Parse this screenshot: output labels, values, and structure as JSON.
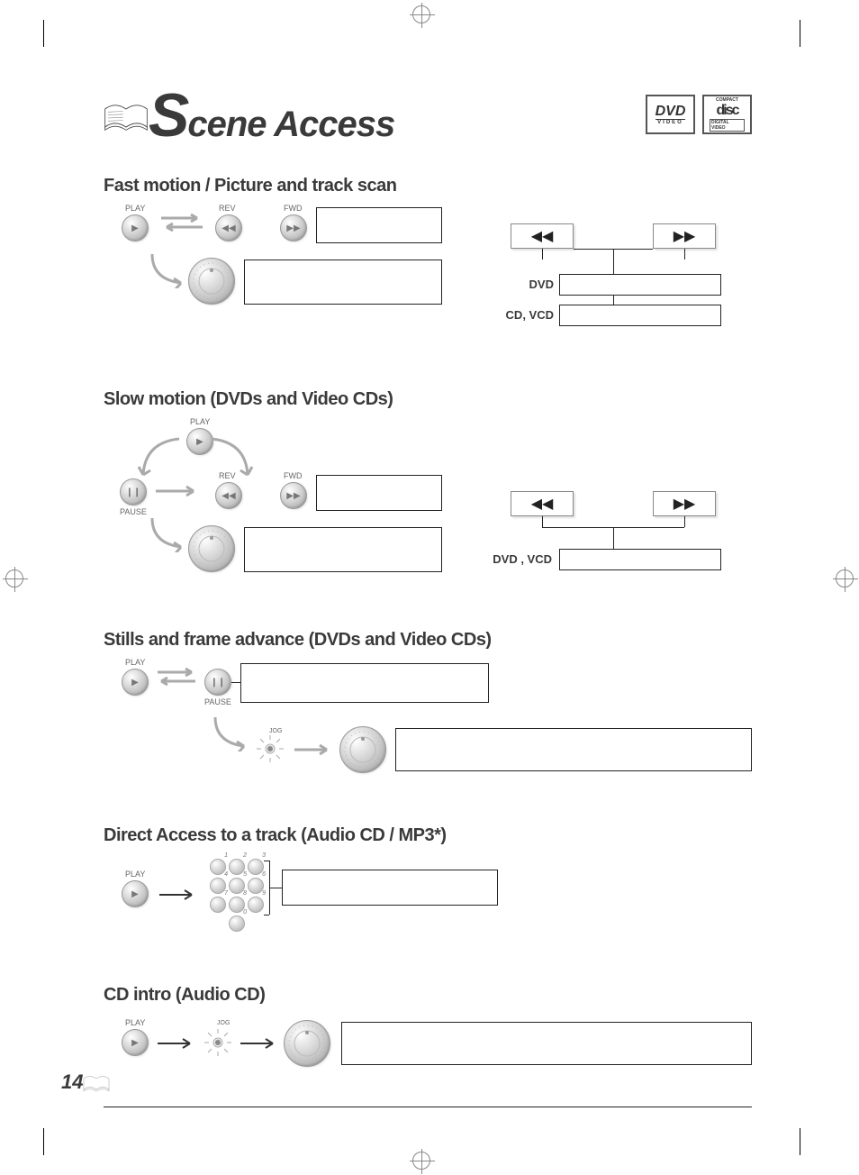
{
  "page_number": "14",
  "title": {
    "big_letter": "S",
    "rest": "cene Access"
  },
  "logos": {
    "dvd": {
      "top": "DVD",
      "bottom": "VIDEO"
    },
    "disc": {
      "top": "COMPACT",
      "mid": "disc",
      "bottom": "DIGITAL VIDEO"
    }
  },
  "sections": {
    "fast": {
      "heading": "Fast motion / Picture and track scan",
      "play": "PLAY",
      "rev": "REV",
      "fwd": "FWD",
      "rows": {
        "dvd": "DVD",
        "cdvcd": "CD, VCD"
      },
      "key_rew": "◀◀",
      "key_ffwd": "▶▶"
    },
    "slow": {
      "heading": "Slow motion (DVDs and Video CDs)",
      "play": "PLAY",
      "pause": "PAUSE",
      "rev": "REV",
      "fwd": "FWD",
      "row": "DVD , VCD",
      "key_rew": "◀◀",
      "key_ffwd": "▶▶"
    },
    "stills": {
      "heading": "Stills and frame advance (DVDs and Video CDs)",
      "play": "PLAY",
      "pause": "PAUSE",
      "jog": "JOG"
    },
    "direct": {
      "heading": "Direct Access to a track (Audio CD / MP3*)",
      "play": "PLAY",
      "digits": [
        "1",
        "2",
        "3",
        "4",
        "5",
        "6",
        "7",
        "8",
        "9",
        "0"
      ]
    },
    "intro": {
      "heading": "CD intro (Audio CD)",
      "play": "PLAY",
      "jog": "JOG"
    }
  },
  "glyphs": {
    "play": "▶",
    "pause": "❙❙",
    "rev": "◀◀",
    "fwd": "▶▶"
  }
}
